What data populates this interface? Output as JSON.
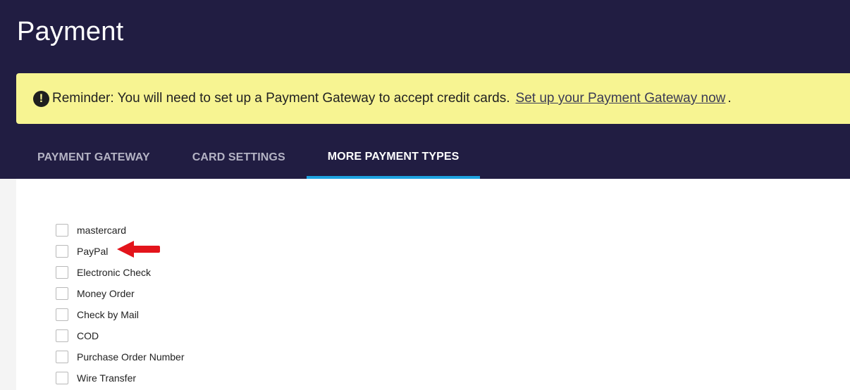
{
  "page": {
    "title": "Payment"
  },
  "reminder": {
    "icon": "exclamation-circle-icon",
    "text": "Reminder: You will need to set up a Payment Gateway to accept credit cards.",
    "link_text": "Set up your Payment Gateway now",
    "trailing": "."
  },
  "tabs": [
    {
      "label": "PAYMENT GATEWAY",
      "active": false
    },
    {
      "label": "CARD SETTINGS",
      "active": false
    },
    {
      "label": "MORE PAYMENT TYPES",
      "active": true
    }
  ],
  "payment_types": [
    {
      "label": "mastercard",
      "checked": false
    },
    {
      "label": "PayPal",
      "checked": false
    },
    {
      "label": "Electronic Check",
      "checked": false
    },
    {
      "label": "Money Order",
      "checked": false
    },
    {
      "label": "Check by Mail",
      "checked": false
    },
    {
      "label": "COD",
      "checked": false
    },
    {
      "label": "Purchase Order Number",
      "checked": false
    },
    {
      "label": "Wire Transfer",
      "checked": false
    }
  ],
  "annotation": {
    "icon": "red-arrow-icon",
    "color": "#e3141b"
  },
  "colors": {
    "header_bg": "#211d42",
    "reminder_bg": "#f7f492",
    "active_tab_underline": "#1ea3e0"
  }
}
